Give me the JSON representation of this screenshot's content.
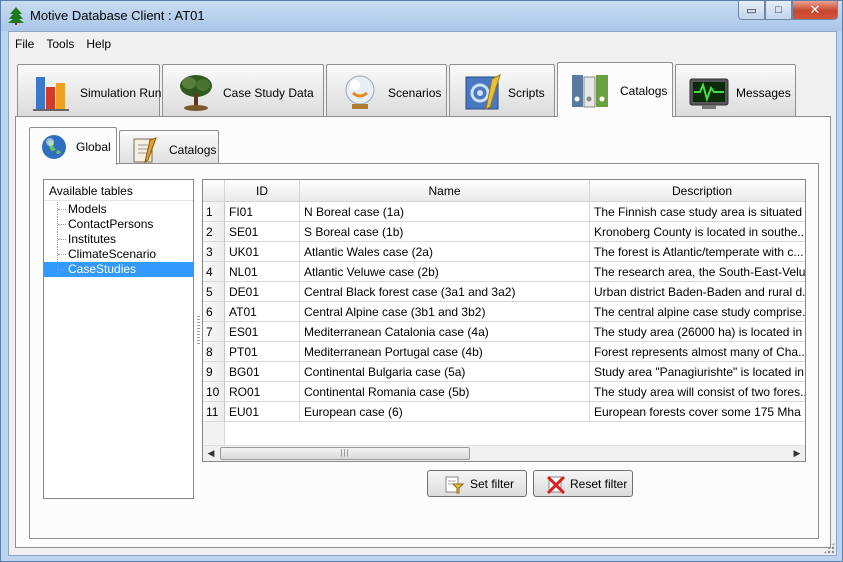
{
  "window": {
    "title": "Motive Database Client : AT01",
    "controls": {
      "minimize": "▭",
      "maximize": "□",
      "close": "✕"
    }
  },
  "menu": [
    "File",
    "Tools",
    "Help"
  ],
  "main_tabs": [
    {
      "label": "Simulation Run",
      "icon": "bar-chart-icon"
    },
    {
      "label": "Case Study Data",
      "icon": "tree-icon"
    },
    {
      "label": "Scenarios",
      "icon": "crystal-ball-icon"
    },
    {
      "label": "Scripts",
      "icon": "script-gear-icon"
    },
    {
      "label": "Catalogs",
      "icon": "binders-icon",
      "active": true
    },
    {
      "label": "Messages",
      "icon": "monitor-icon"
    }
  ],
  "sub_tabs": [
    {
      "label": "Global",
      "icon": "globe-icon",
      "active": true
    },
    {
      "label": "Catalogs",
      "icon": "notepad-icon"
    }
  ],
  "tree": {
    "header": "Available tables",
    "items": [
      "Models",
      "ContactPersons",
      "Institutes",
      "ClimateScenario",
      "CaseStudies"
    ],
    "selected": "CaseStudies"
  },
  "table": {
    "columns": [
      "ID",
      "Name",
      "Description"
    ],
    "rows": [
      {
        "n": "1",
        "id": "FI01",
        "name": "N Boreal case (1a)",
        "desc": "The Finnish case study area is situated ..."
      },
      {
        "n": "2",
        "id": "SE01",
        "name": "S Boreal case (1b)",
        "desc": "Kronoberg County is located in southe..."
      },
      {
        "n": "3",
        "id": "UK01",
        "name": "Atlantic Wales case (2a)",
        "desc": "The forest is Atlantic/temperate with c..."
      },
      {
        "n": "4",
        "id": "NL01",
        "name": "Atlantic Veluwe case (2b)",
        "desc": "The research area, the South-East-Velu..."
      },
      {
        "n": "5",
        "id": "DE01",
        "name": "Central Black forest case (3a1 and 3a2)",
        "desc": "Urban district Baden-Baden and rural d..."
      },
      {
        "n": "6",
        "id": "AT01",
        "name": "Central Alpine case (3b1 and 3b2)",
        "desc": "The central alpine case study comprise..."
      },
      {
        "n": "7",
        "id": "ES01",
        "name": "Mediterranean Catalonia case (4a)",
        "desc": "The study area (26000 ha) is located in ..."
      },
      {
        "n": "8",
        "id": "PT01",
        "name": "Mediterranean Portugal case (4b)",
        "desc": "Forest represents almost many of Cha..."
      },
      {
        "n": "9",
        "id": "BG01",
        "name": "Continental Bulgaria case (5a)",
        "desc": "Study area \"Panagiurishte\" is located in..."
      },
      {
        "n": "10",
        "id": "RO01",
        "name": "Continental Romania case (5b)",
        "desc": "The study area will consist of two fores..."
      },
      {
        "n": "11",
        "id": "EU01",
        "name": "European case (6)",
        "desc": "European forests cover some 175 Mha ..."
      }
    ]
  },
  "buttons": {
    "set_filter": "Set filter",
    "reset_filter": "Reset filter"
  }
}
